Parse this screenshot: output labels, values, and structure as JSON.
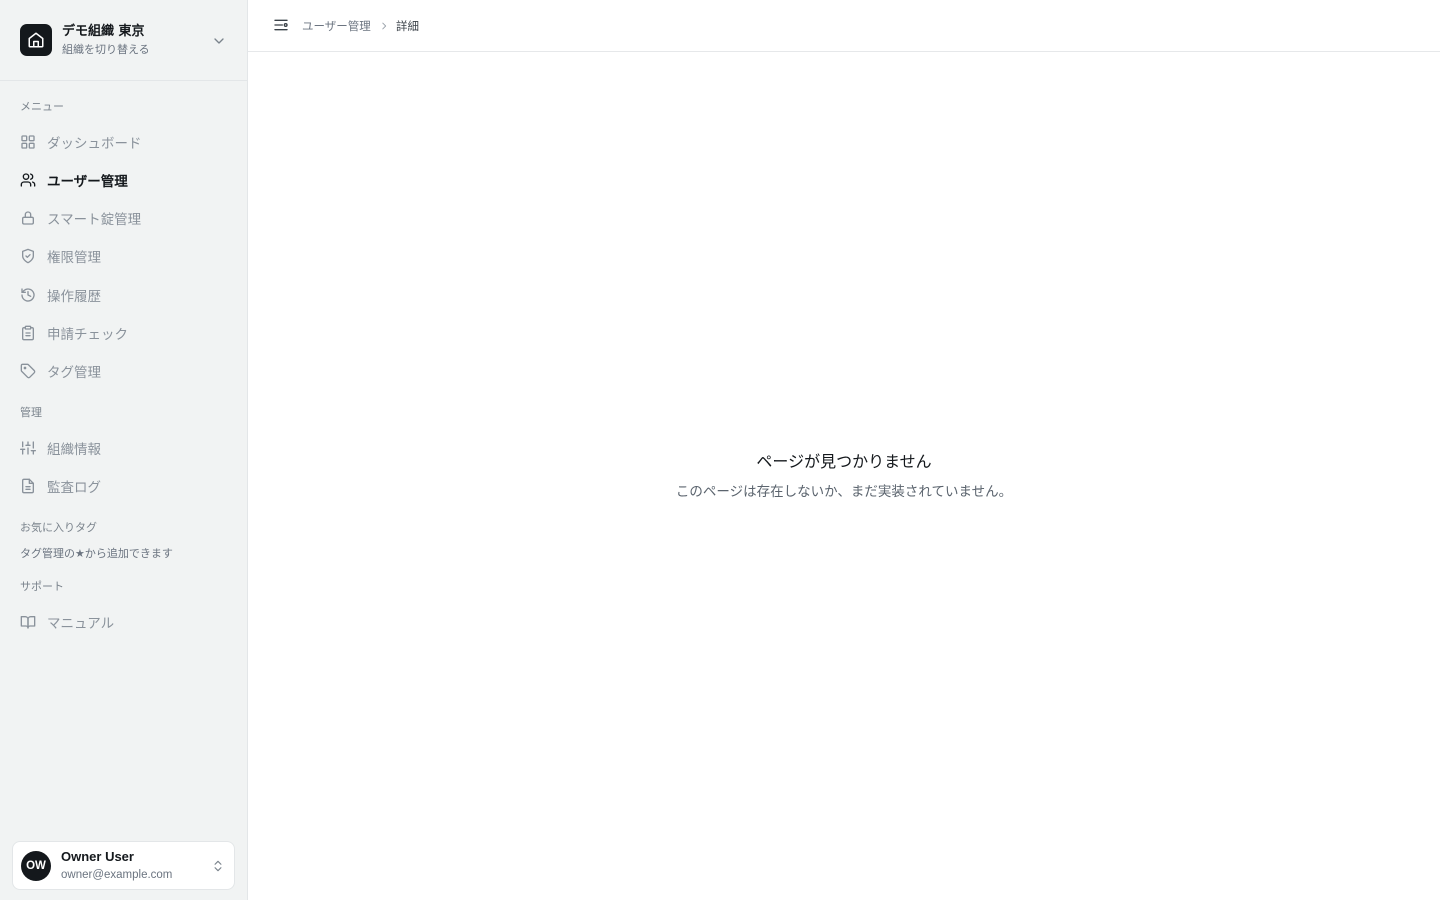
{
  "org": {
    "name": "デモ組織 東京",
    "subtitle": "組織を切り替える"
  },
  "sidebar": {
    "menu_section": "メニュー",
    "menu_items": [
      {
        "label": "ダッシュボード",
        "icon": "grid-icon"
      },
      {
        "label": "ユーザー管理",
        "icon": "users-icon",
        "active": true
      },
      {
        "label": "スマート錠管理",
        "icon": "lock-icon"
      },
      {
        "label": "権限管理",
        "icon": "shield-check-icon"
      },
      {
        "label": "操作履歴",
        "icon": "history-icon"
      },
      {
        "label": "申請チェック",
        "icon": "clipboard-icon"
      },
      {
        "label": "タグ管理",
        "icon": "tag-icon"
      }
    ],
    "admin_section": "管理",
    "admin_items": [
      {
        "label": "組織情報",
        "icon": "sliders-icon"
      },
      {
        "label": "監査ログ",
        "icon": "file-text-icon"
      }
    ],
    "favorites_section": "お気に入りタグ",
    "favorites_hint": "タグ管理の★から追加できます",
    "support_section": "サポート",
    "support_items": [
      {
        "label": "マニュアル",
        "icon": "book-open-icon"
      }
    ]
  },
  "user": {
    "initials": "OW",
    "name": "Owner User",
    "email": "owner@example.com"
  },
  "breadcrumb": {
    "parent": "ユーザー管理",
    "current": "詳細"
  },
  "not_found": {
    "title": "ページが見つかりません",
    "description": "このページは存在しないか、まだ実装されていません。"
  }
}
